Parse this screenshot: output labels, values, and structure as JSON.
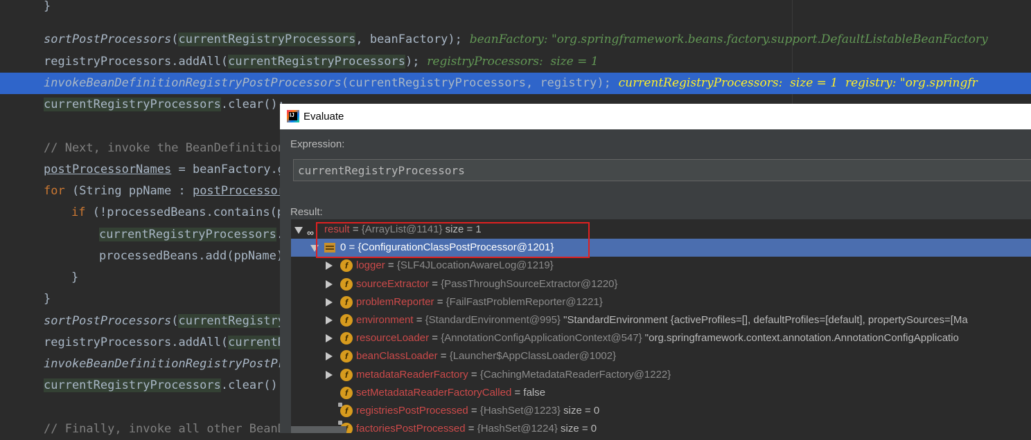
{
  "editor": {
    "lines": [
      {
        "tokens": [
          {
            "t": "}",
            "c": ""
          }
        ]
      },
      {
        "tokens": [
          {
            "t": "sortPostProcessors",
            "c": "it"
          },
          {
            "t": "(",
            "c": ""
          },
          {
            "t": "currentRegistryProcessors",
            "c": "var"
          },
          {
            "t": ", beanFactory);",
            "c": ""
          },
          {
            "t": "  beanFactory: \"org.springframework.beans.factory.support.DefaultListableBeanFactory",
            "c": "inl"
          }
        ]
      },
      {
        "tokens": [
          {
            "t": "registryProcessors.addAll(",
            "c": ""
          },
          {
            "t": "currentRegistryProcessors",
            "c": "var"
          },
          {
            "t": ");",
            "c": ""
          },
          {
            "t": "  registryProcessors:  size = 1",
            "c": "inl"
          }
        ]
      },
      {
        "tokens": [
          {
            "t": "invokeBeanDefinitionRegistryPostProcessors",
            "c": "it"
          },
          {
            "t": "(currentRegistryProcessors, registry);",
            "c": ""
          },
          {
            "t": "  currentRegistryProcessors:  size = 1  registry: \"org.springfr",
            "c": "inl hlc"
          }
        ]
      },
      {
        "tokens": [
          {
            "t": "currentRegistryProcessors",
            "c": "var"
          },
          {
            "t": ".clear();",
            "c": ""
          }
        ]
      },
      {
        "tokens": []
      },
      {
        "tokens": [
          {
            "t": "// Next, invoke the BeanDefinition",
            "c": "cm"
          }
        ]
      },
      {
        "tokens": [
          {
            "t": "postProcessorNames",
            "c": "ul"
          },
          {
            "t": " = beanFactory.g",
            "c": ""
          }
        ]
      },
      {
        "tokens": [
          {
            "t": "for",
            "c": "kw"
          },
          {
            "t": " (String ppName : ",
            "c": ""
          },
          {
            "t": "postProcessor",
            "c": "ul"
          }
        ]
      },
      {
        "tokens": [
          {
            "t": "if",
            "c": "kw"
          },
          {
            "t": " (!processedBeans.contains(p",
            "c": ""
          }
        ]
      },
      {
        "tokens": [
          {
            "t": "currentRegistryProcessors",
            "c": "var"
          },
          {
            "t": ".",
            "c": ""
          }
        ]
      },
      {
        "tokens": [
          {
            "t": "processedBeans.add(ppName)",
            "c": ""
          }
        ]
      },
      {
        "tokens": [
          {
            "t": "}",
            "c": ""
          }
        ]
      },
      {
        "tokens": [
          {
            "t": "}",
            "c": ""
          }
        ]
      },
      {
        "tokens": [
          {
            "t": "sortPostProcessors",
            "c": "it"
          },
          {
            "t": "(",
            "c": ""
          },
          {
            "t": "currentRegistry",
            "c": "var"
          }
        ]
      },
      {
        "tokens": [
          {
            "t": "registryProcessors.addAll(",
            "c": ""
          },
          {
            "t": "currentR",
            "c": "var"
          }
        ]
      },
      {
        "tokens": [
          {
            "t": "invokeBeanDefinitionRegistryPostPr",
            "c": "it"
          }
        ]
      },
      {
        "tokens": [
          {
            "t": "currentRegistryProcessors",
            "c": "var"
          },
          {
            "t": ".clear();",
            "c": ""
          }
        ]
      },
      {
        "tokens": []
      },
      {
        "tokens": [
          {
            "t": "// Finally, invoke all other BeanD",
            "c": "cm"
          }
        ]
      }
    ]
  },
  "dialog": {
    "title": "Evaluate",
    "expression_label": "Expression:",
    "expression_value": "currentRegistryProcessors",
    "result_label": "Result:",
    "tree": [
      {
        "name": "result",
        "obj": "{ArrayList@1141}",
        "extra": " size = 1",
        "icon": "oo",
        "expanded": true,
        "level": 0
      },
      {
        "name": "0",
        "obj": "{ConfigurationClassPostProcessor@1201}",
        "extra": "",
        "icon": "arr",
        "expanded": true,
        "level": 1,
        "selected": true
      },
      {
        "name": "logger",
        "obj": "{SLF4JLocationAwareLog@1219}",
        "extra": "",
        "icon": "f",
        "expandable": true,
        "level": 2
      },
      {
        "name": "sourceExtractor",
        "obj": "{PassThroughSourceExtractor@1220}",
        "extra": "",
        "icon": "f",
        "expandable": true,
        "level": 2
      },
      {
        "name": "problemReporter",
        "obj": "{FailFastProblemReporter@1221}",
        "extra": "",
        "icon": "f",
        "expandable": true,
        "level": 2
      },
      {
        "name": "environment",
        "obj": "{StandardEnvironment@995}",
        "extra": " \"StandardEnvironment {activeProfiles=[], defaultProfiles=[default], propertySources=[Ma",
        "icon": "f",
        "expandable": true,
        "level": 2
      },
      {
        "name": "resourceLoader",
        "obj": "{AnnotationConfigApplicationContext@547}",
        "extra": " \"org.springframework.context.annotation.AnnotationConfigApplicatio",
        "icon": "f",
        "expandable": true,
        "level": 2
      },
      {
        "name": "beanClassLoader",
        "obj": "{Launcher$AppClassLoader@1002}",
        "extra": "",
        "icon": "f",
        "expandable": true,
        "level": 2
      },
      {
        "name": "metadataReaderFactory",
        "obj": "{CachingMetadataReaderFactory@1222}",
        "extra": "",
        "icon": "f",
        "expandable": true,
        "level": 2
      },
      {
        "name": "setMetadataReaderFactoryCalled",
        "obj": "",
        "extra": "false",
        "icon": "f",
        "expandable": false,
        "level": 2
      },
      {
        "name": "registriesPostProcessed",
        "obj": "{HashSet@1223}",
        "extra": "  size = 0",
        "icon": "flock",
        "expandable": false,
        "level": 2
      },
      {
        "name": "factoriesPostProcessed",
        "obj": "{HashSet@1224}",
        "extra": "  size = 0",
        "icon": "flock",
        "expandable": false,
        "level": 2
      }
    ]
  }
}
